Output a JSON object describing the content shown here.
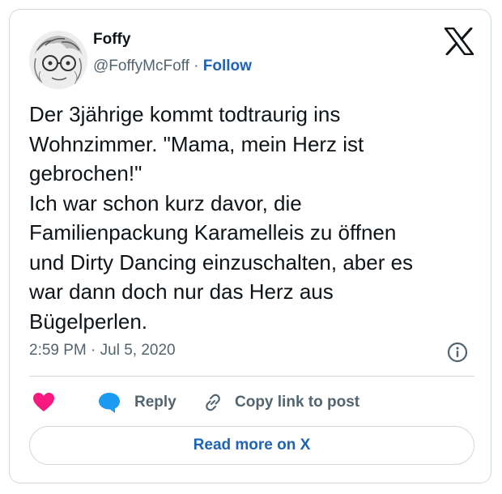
{
  "tweet": {
    "display_name": "Foffy",
    "handle": "@FoffyMcFoff",
    "separator": " · ",
    "follow_label": "Follow",
    "text_lines": [
      "Der 3jährige kommt todtraurig ins",
      "Wohnzimmer. \"Mama, mein Herz ist",
      "gebrochen!\"",
      "Ich war schon kurz davor, die",
      "Familienpackung Karamelleis zu öffnen",
      "und Dirty Dancing einzuschalten, aber es",
      "war dann doch nur das Herz aus",
      "Bügelperlen."
    ],
    "timestamp": "2:59 PM · Jul 5, 2020"
  },
  "actions": {
    "reply_label": "Reply",
    "copy_link_label": "Copy link to post"
  },
  "footer": {
    "read_more_label": "Read more on X"
  },
  "icons": {
    "brand": "x-logo-icon",
    "info": "info-icon",
    "like": "heart-icon",
    "reply": "speech-bubble-icon",
    "copy": "link-icon"
  },
  "colors": {
    "text": "#0f1419",
    "muted": "#536471",
    "link": "#1d63b8",
    "heart": "#f91880",
    "reply_bubble": "#1d9bf0",
    "border": "#cfd9de"
  }
}
